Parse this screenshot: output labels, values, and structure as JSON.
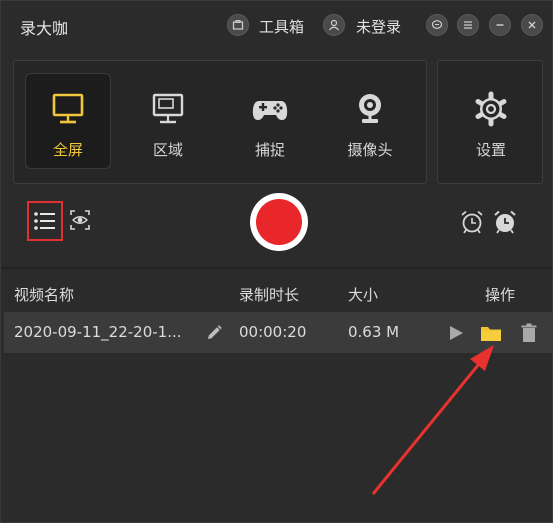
{
  "app": {
    "title": "录大咖"
  },
  "titlebar": {
    "toolbox_label": "工具箱",
    "login_label": "未登录"
  },
  "modes": [
    {
      "label": "全屏",
      "icon": "monitor-icon",
      "active": true
    },
    {
      "label": "区域",
      "icon": "region-monitor-icon",
      "active": false
    },
    {
      "label": "捕捉",
      "icon": "gamepad-icon",
      "active": false
    },
    {
      "label": "摄像头",
      "icon": "webcam-icon",
      "active": false
    }
  ],
  "settings": {
    "label": "设置",
    "icon": "gear-icon"
  },
  "colors": {
    "accent": "#f0c63a",
    "record": "#e9262a",
    "folder": "#f2c12e",
    "highlight": "#e03030"
  },
  "table": {
    "headers": {
      "name": "视频名称",
      "duration": "录制时长",
      "size": "大小",
      "actions": "操作"
    },
    "rows": [
      {
        "name": "2020-09-11_22-20-1...",
        "duration": "00:00:20",
        "size": "0.63 M"
      }
    ]
  }
}
